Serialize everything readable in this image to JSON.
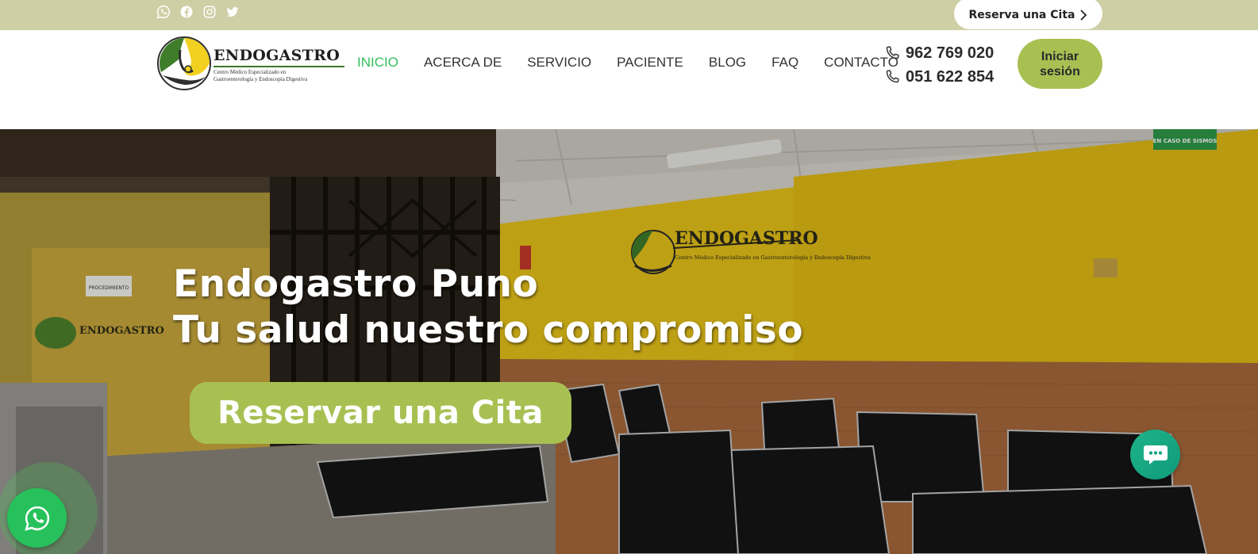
{
  "topbar": {
    "social_icons": [
      "whatsapp-icon",
      "facebook-icon",
      "instagram-icon",
      "twitter-icon"
    ],
    "reserve_label": "Reserva una Cita",
    "background": "#cfcfa6"
  },
  "header": {
    "logo": {
      "name": "EndoGastro",
      "subtitle_line1": "Centro Médico Especializado en",
      "subtitle_line2": "Gastroenterología y Endoscopía Digestiva"
    },
    "nav": [
      {
        "label": "INICIO",
        "active": true
      },
      {
        "label": "ACERCA DE",
        "active": false
      },
      {
        "label": "SERVICIO",
        "active": false
      },
      {
        "label": "PACIENTE",
        "active": false
      },
      {
        "label": "BLOG",
        "active": false
      },
      {
        "label": "FAQ",
        "active": false
      },
      {
        "label": "CONTACTO",
        "active": false
      }
    ],
    "phones": [
      "962 769 020",
      "051 622 854"
    ],
    "login_label": "Iniciar sesión"
  },
  "hero": {
    "title_line1": "Endogastro Puno",
    "title_line2": "Tu salud nuestro compromiso",
    "cta_label": "Reservar una Cita",
    "wall_sign": "ENDOGASTRO",
    "wall_sign_sub": "Centro Médico Especializado en Gastroenterología y Endoscopía Digestiva",
    "door_sign": "PROCEDIMIENTO",
    "corner_sign": "EN CASO DE SISMOS"
  },
  "colors": {
    "accent_green": "#a8c052",
    "nav_active": "#2fbf5c",
    "whatsapp": "#27c15c",
    "chat": "#1fb488"
  }
}
